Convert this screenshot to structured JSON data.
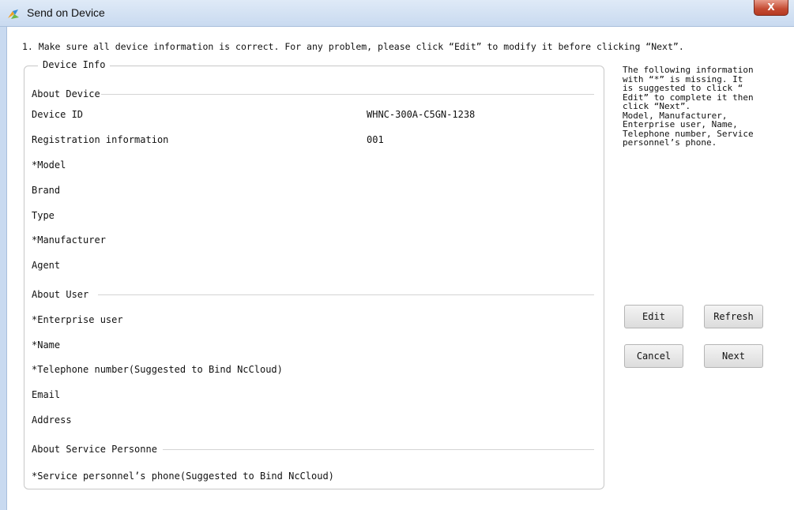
{
  "window": {
    "title": "Send on Device",
    "close_glyph": "X",
    "icon": "app-logo-icon"
  },
  "instruction": "1. Make sure all device information is correct. For any problem, please click “Edit” to modify it before clicking “Next”.",
  "device_info": {
    "title": "Device Info",
    "about_device": {
      "header": "About Device",
      "rows": [
        {
          "label": "Device ID",
          "value": "WHNC-300A-C5GN-1238"
        },
        {
          "label": "Registration information",
          "value": "001"
        },
        {
          "label": "*Model",
          "value": ""
        },
        {
          "label": "Brand",
          "value": ""
        },
        {
          "label": "Type",
          "value": ""
        },
        {
          "label": "*Manufacturer",
          "value": ""
        },
        {
          "label": "Agent",
          "value": ""
        }
      ]
    },
    "about_user": {
      "header": "About User",
      "rows": [
        {
          "label": "*Enterprise user",
          "value": ""
        },
        {
          "label": "*Name",
          "value": ""
        },
        {
          "label": "*Telephone number(Suggested to Bind NcCloud)",
          "value": ""
        },
        {
          "label": "Email",
          "value": ""
        },
        {
          "label": "Address",
          "value": ""
        }
      ]
    },
    "about_service": {
      "header": "About Service Personne",
      "rows": [
        {
          "label": "*Service personnel’s phone(Suggested to Bind NcCloud)",
          "value": ""
        }
      ]
    }
  },
  "hint": {
    "lines": [
      "The following information",
      "with “*” is missing. It",
      "is suggested to click “",
      "Edit” to complete it then",
      "click “Next”.",
      "Model, Manufacturer,",
      "Enterprise user, Name,",
      "Telephone number, Service",
      "personnel’s phone."
    ]
  },
  "buttons": {
    "edit": "Edit",
    "refresh": "Refresh",
    "cancel": "Cancel",
    "next": "Next"
  }
}
